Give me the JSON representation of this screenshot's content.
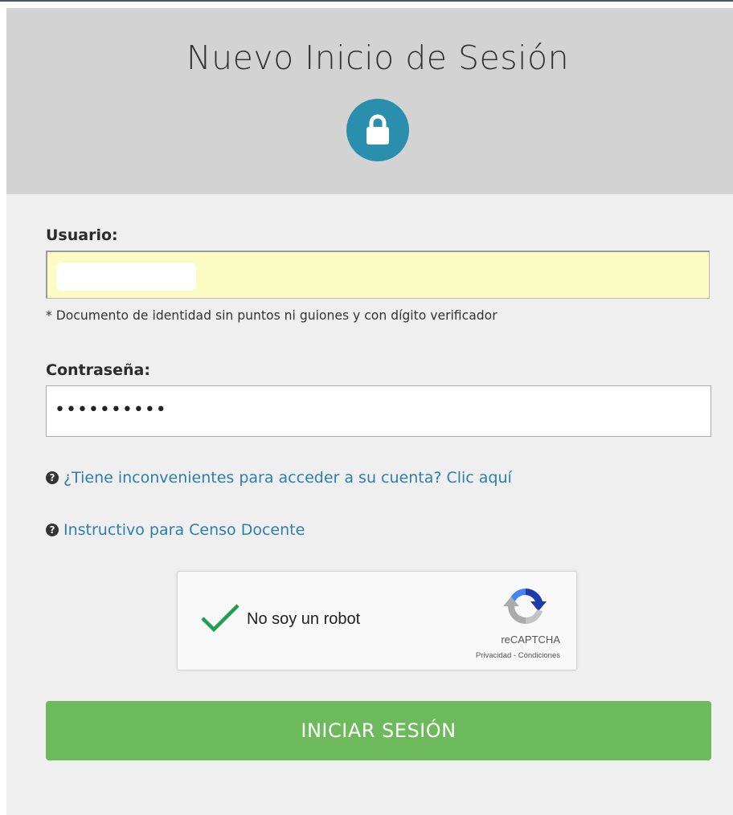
{
  "header": {
    "title": "Nuevo Inicio de Sesión",
    "icon": "lock-icon",
    "icon_color": "#2a8fad"
  },
  "form": {
    "username_label": "Usuario:",
    "username_value": "",
    "username_hint": "* Documento de identidad sin puntos ni guiones y con dígito verificador",
    "password_label": "Contraseña:",
    "password_masked": "••••••••••"
  },
  "links": [
    {
      "icon": "question-circle-icon",
      "text": "¿Tiene inconvenientes para acceder a su cuenta? Clic aquí"
    },
    {
      "icon": "question-circle-icon",
      "text": "Instructivo para Censo Docente"
    }
  ],
  "captcha": {
    "label": "No soy un robot",
    "brand": "reCAPTCHA",
    "footer_links": "Privacidad - Condiciones",
    "checked": true,
    "check_color": "#1e9e4f"
  },
  "submit": {
    "label": "INICIAR SESIÓN",
    "color": "#6cba5b"
  }
}
